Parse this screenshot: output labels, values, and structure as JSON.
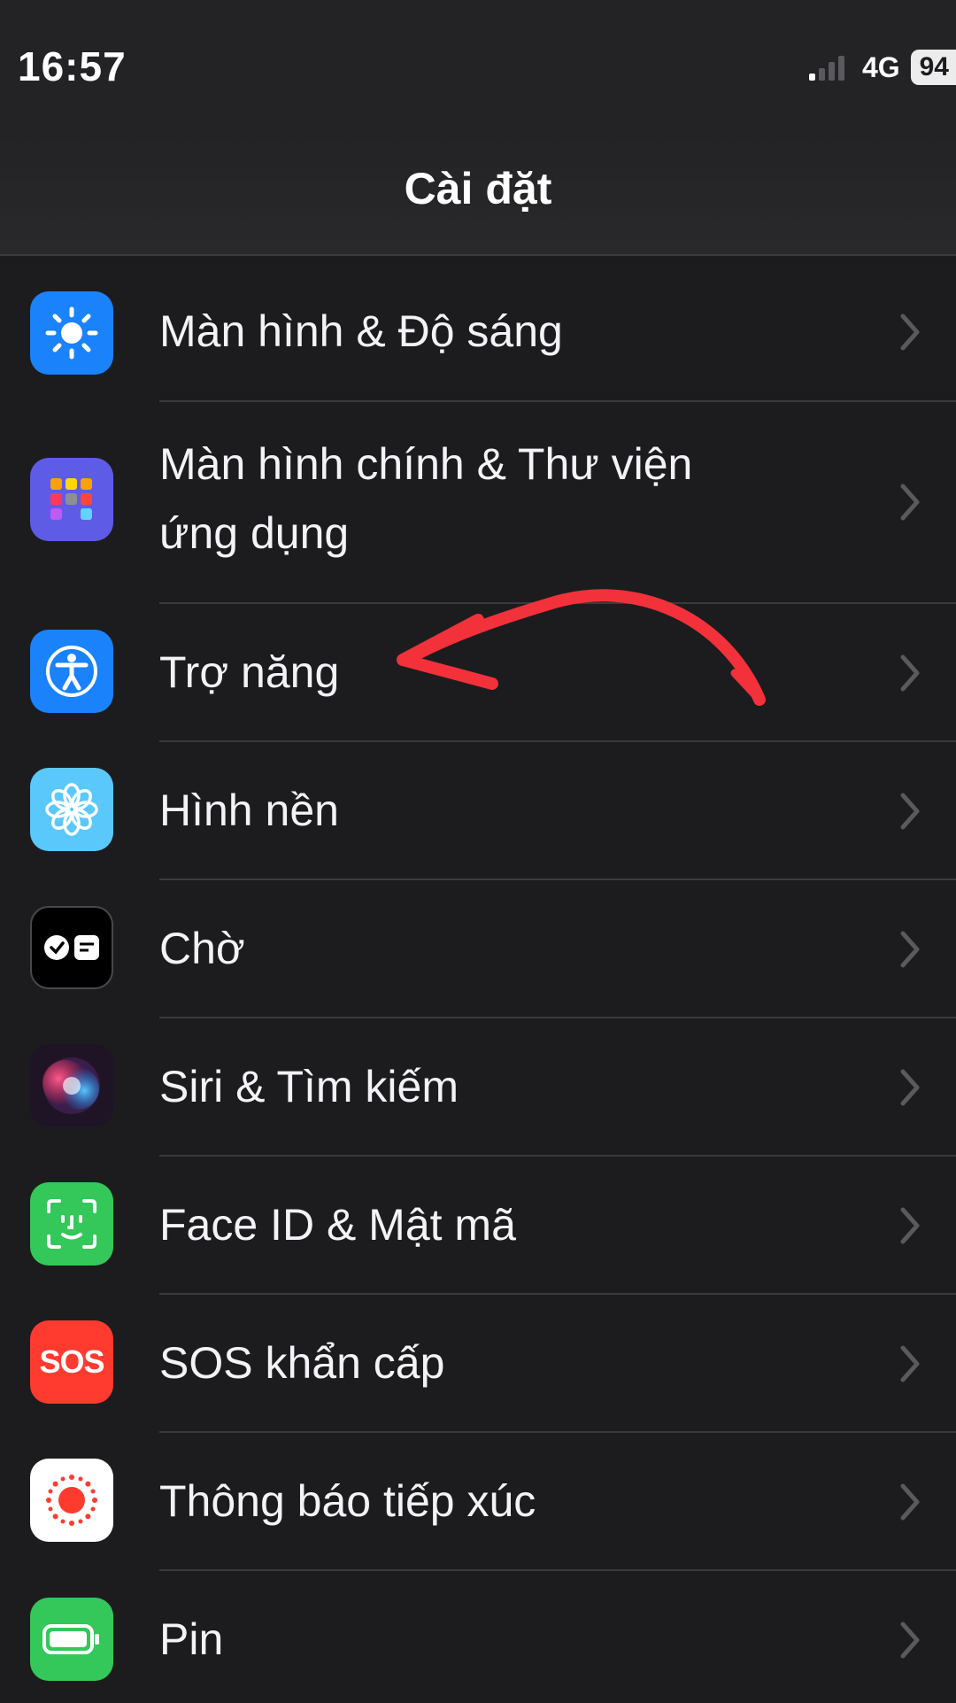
{
  "status_bar": {
    "time": "16:57",
    "signal_bars_active": 1,
    "signal_bars_total": 4,
    "network": "4G",
    "battery": "94"
  },
  "header": {
    "title": "Cài đặt"
  },
  "settings": {
    "items": [
      {
        "label": "Màn hình & Độ sáng",
        "icon": "brightness-icon",
        "color": "#1a82fb"
      },
      {
        "label_line1": "Màn hình chính & Thư viện",
        "label_line2": "ứng dụng",
        "icon": "home-screen-grid-icon",
        "color": "#5e5ce6"
      },
      {
        "label": "Trợ năng",
        "icon": "accessibility-icon",
        "color": "#1a82fb"
      },
      {
        "label": "Hình nền",
        "icon": "wallpaper-flower-icon",
        "color": "#5ac8fa"
      },
      {
        "label": "Chờ",
        "icon": "standby-icon",
        "color": "#000000"
      },
      {
        "label": "Siri & Tìm kiếm",
        "icon": "siri-icon",
        "color": "#2a1a3a"
      },
      {
        "label": "Face ID & Mật mã",
        "icon": "face-id-icon",
        "color": "#34c759"
      },
      {
        "label": "SOS khẩn cấp",
        "icon": "sos-icon",
        "icon_text": "SOS",
        "color": "#ff3b30"
      },
      {
        "label": "Thông báo tiếp xúc",
        "icon": "exposure-notification-icon",
        "color": "#ffffff"
      },
      {
        "label": "Pin",
        "icon": "battery-icon",
        "color": "#34c759"
      }
    ]
  },
  "annotation": {
    "arrow_color": "#f2313a",
    "points_to": "Trợ năng"
  }
}
